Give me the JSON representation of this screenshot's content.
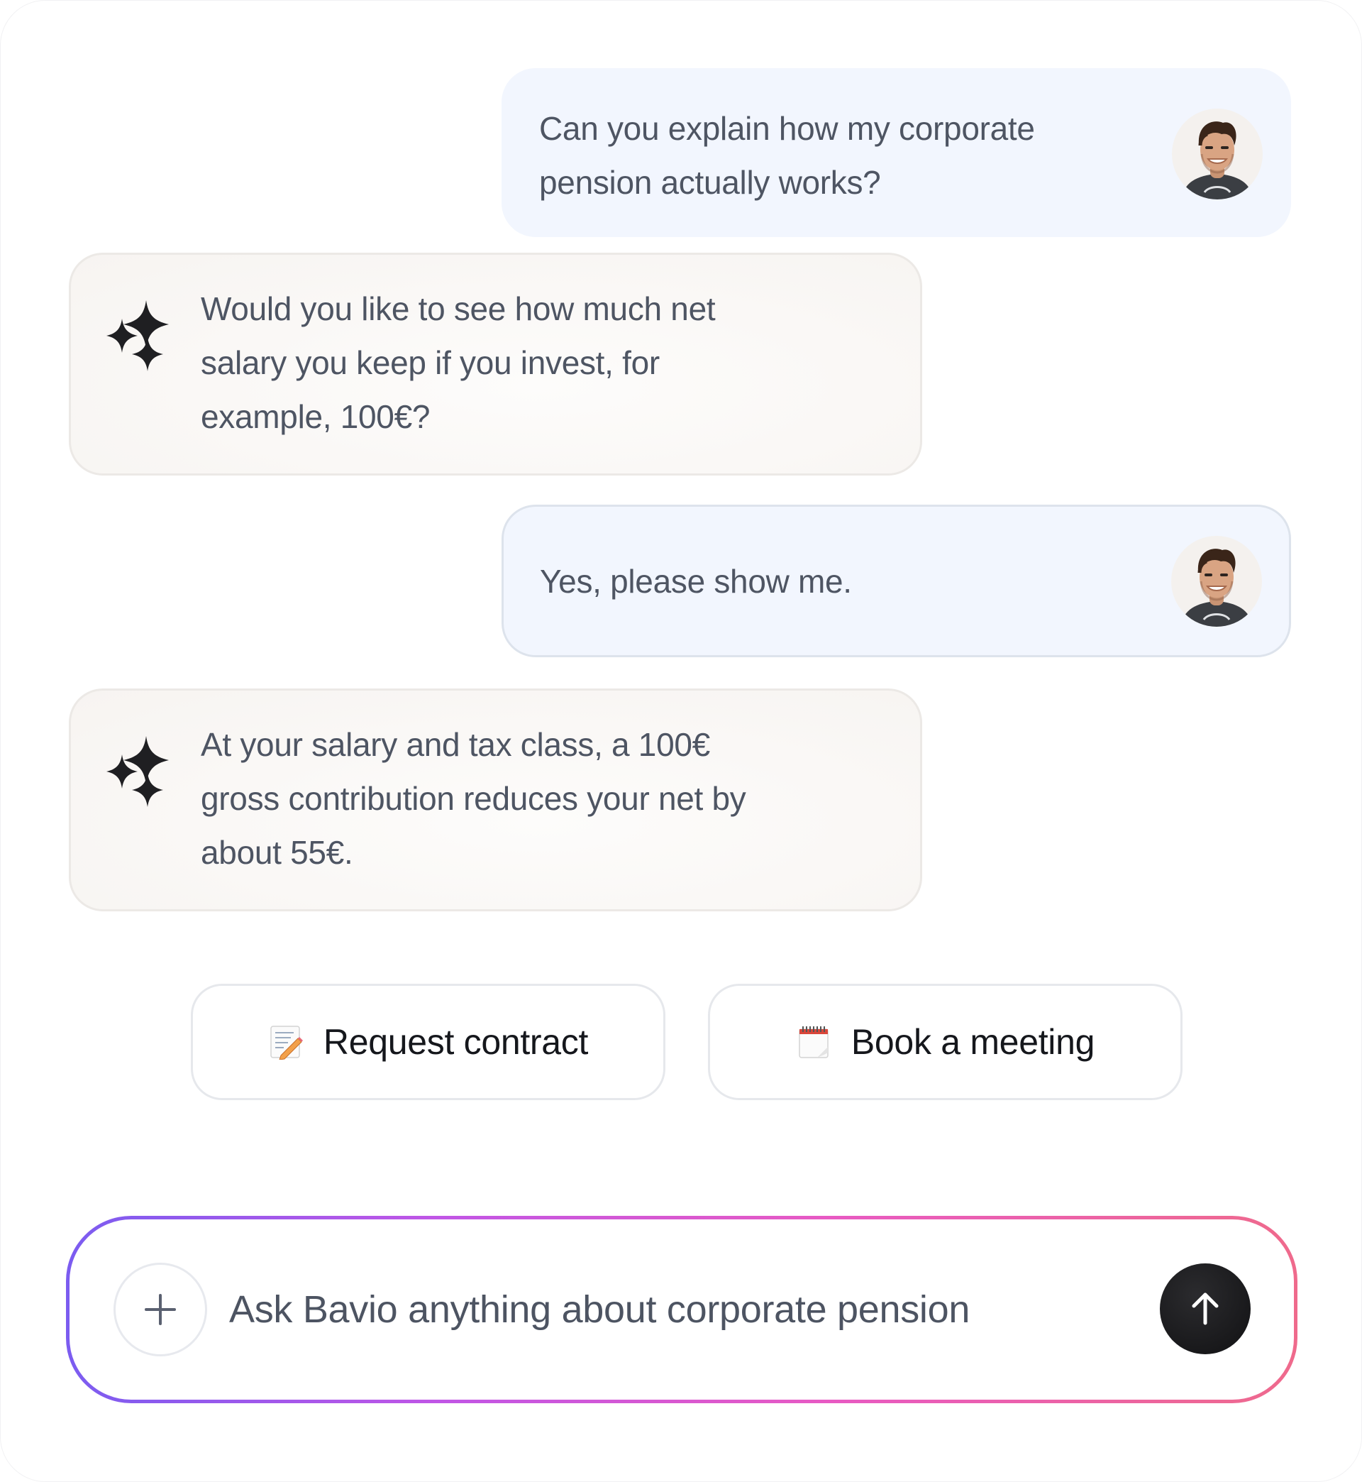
{
  "chat": {
    "messages": [
      {
        "role": "user",
        "text": "Can you explain how my corporate\npension actually works?",
        "avatar_icon": "user-avatar-photo"
      },
      {
        "role": "assistant",
        "text": "Would you like to see how much net\nsalary you keep if you invest, for\nexample, 100€?",
        "icon": "sparkle-icon"
      },
      {
        "role": "user",
        "text": "Yes, please show me.",
        "avatar_icon": "user-avatar-photo"
      },
      {
        "role": "assistant",
        "text": "At your salary and tax class, a 100€\ngross contribution reduces your net by\nabout 55€.",
        "icon": "sparkle-icon"
      }
    ]
  },
  "actions": {
    "request_contract": {
      "label": "Request contract",
      "icon": "memo-icon"
    },
    "book_meeting": {
      "label": "Book a meeting",
      "icon": "spiral-calendar-icon"
    }
  },
  "composer": {
    "placeholder": "Ask Bavio anything about corporate pension",
    "attach_icon": "plus-icon",
    "send_icon": "arrow-up-icon",
    "border_gradient": [
      "#7b5cf0",
      "#c056e6",
      "#e85ac3",
      "#ef6a8c"
    ]
  },
  "colors": {
    "user_bubble": "#f2f6fe",
    "assistant_bubble": "#f7f4f1",
    "text": "#4e5563",
    "send_button": "#111113"
  }
}
